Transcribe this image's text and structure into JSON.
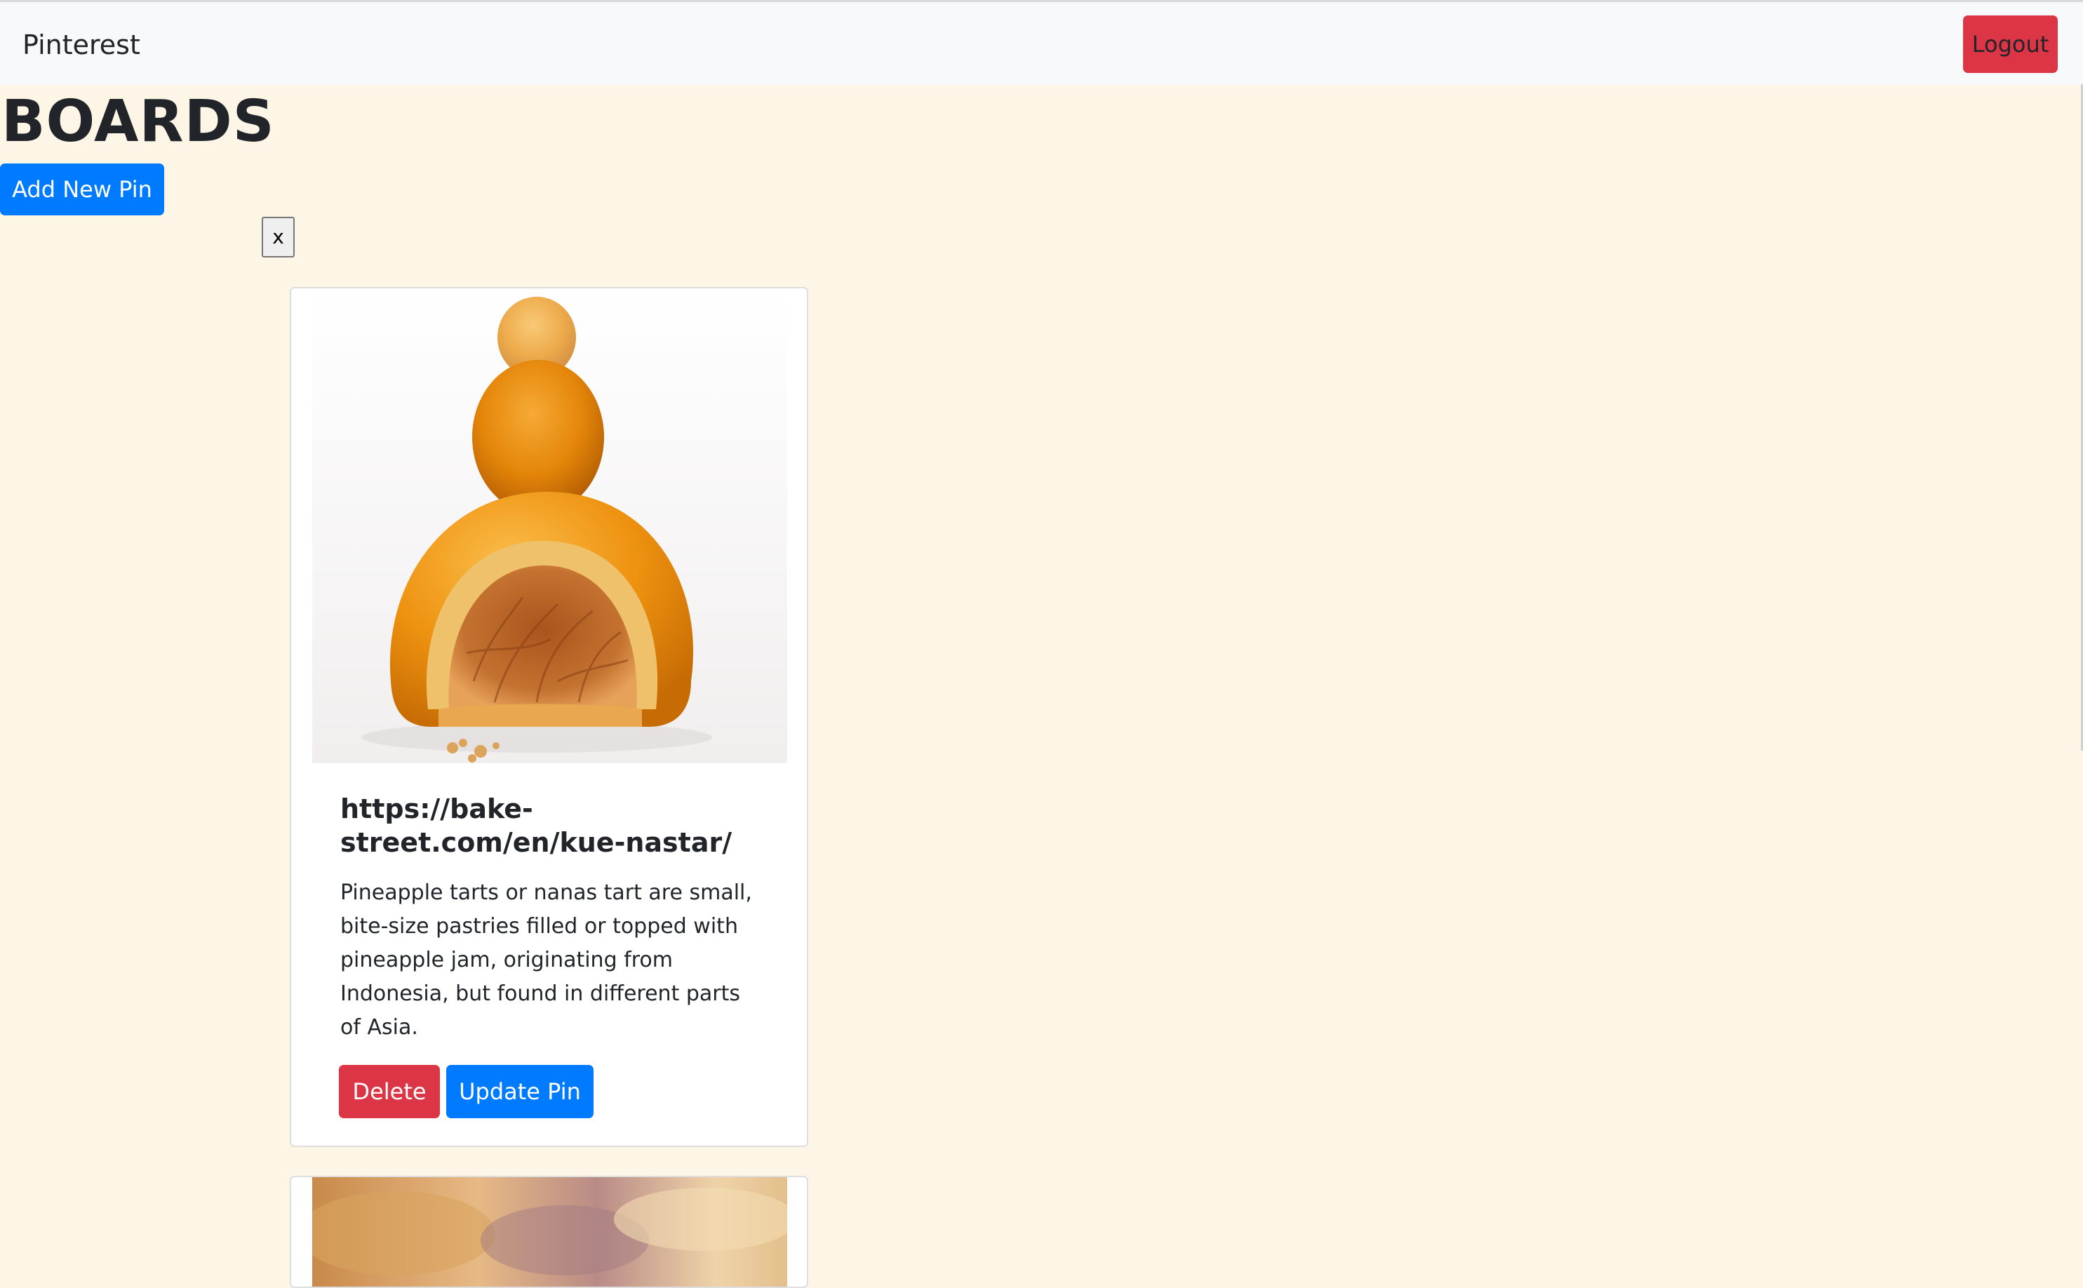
{
  "navbar": {
    "brand": "Pinterest",
    "logout_label": "Logout"
  },
  "page": {
    "title": "BOARDS",
    "add_pin_label": "Add New Pin",
    "close_label": "x"
  },
  "pins": [
    {
      "title": "https://bake-street.com/en/kue-nastar/",
      "description": "Pineapple tarts or nanas tart are small, bite-size pastries filled or topped with pineapple jam, originating from Indonesia, but found in different parts of Asia.",
      "image": "pineapple-tart-photo",
      "delete_label": "Delete",
      "update_label": "Update Pin"
    },
    {
      "image": "pastry-photo"
    }
  ],
  "colors": {
    "page_background": "#fdf5e6",
    "navbar_background": "#f8f9fa",
    "primary": "#007bff",
    "danger": "#dc3545"
  }
}
